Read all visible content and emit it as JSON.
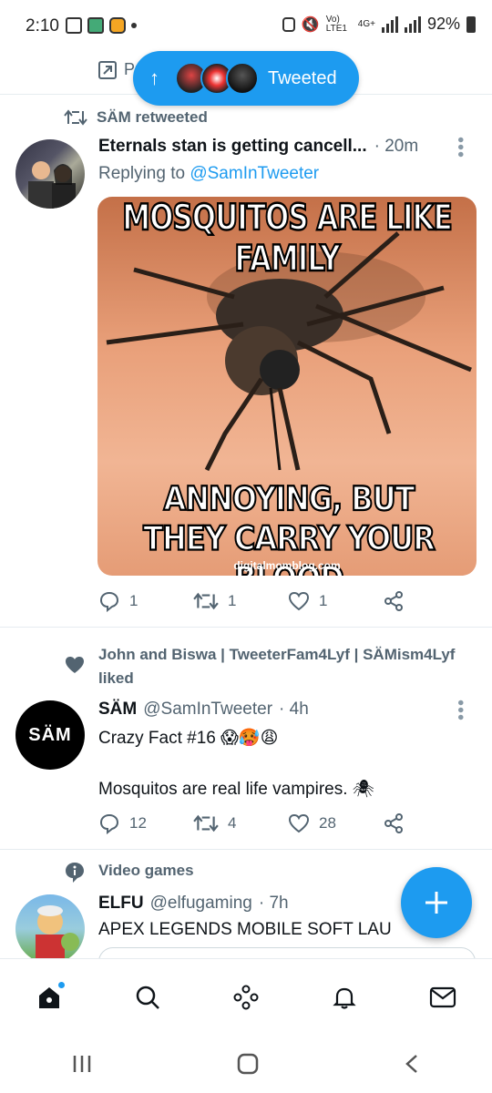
{
  "status_bar": {
    "time": "2:10",
    "network_label": "Vo) LTE1",
    "net_type": "4G+",
    "battery": "92%"
  },
  "tweeted_pill": {
    "label": "Tweeted"
  },
  "peek_item": {
    "label": "Pr"
  },
  "tweet1": {
    "social_context": "SÄM retweeted",
    "author_name": "Eternals stan is getting cancell...",
    "time": "· 20m",
    "replying_prefix": "Replying to",
    "replying_handle": "@SamInTweeter",
    "meme_top": "MOSQUITOS ARE LIKE FAMILY",
    "meme_bottom": "ANNOYING, BUT THEY CARRY YOUR BLOOD",
    "meme_watermark": "digitalmomblog.com",
    "replies": "1",
    "retweets": "1",
    "likes": "1"
  },
  "tweet2": {
    "social_context": "John and Biswa | TweeterFam4Lyf | SÄMism4Lyf liked",
    "author_name": "SÄM",
    "handle": "@SamInTweeter",
    "time": "· 4h",
    "line1": "Crazy Fact #16 😱🥵😩",
    "line2": "Mosquitos are real life vampires. 🕷",
    "avatar_text": "SÄM",
    "replies": "12",
    "retweets": "4",
    "likes": "28"
  },
  "tweet3": {
    "social_context": "Video games",
    "author_name": "ELFU",
    "handle": "@elfugaming",
    "time": "· 7h",
    "text": "APEX LEGENDS MOBILE SOFT LAU"
  },
  "colors": {
    "accent": "#1d9bf0",
    "secondary_text": "#536471"
  }
}
